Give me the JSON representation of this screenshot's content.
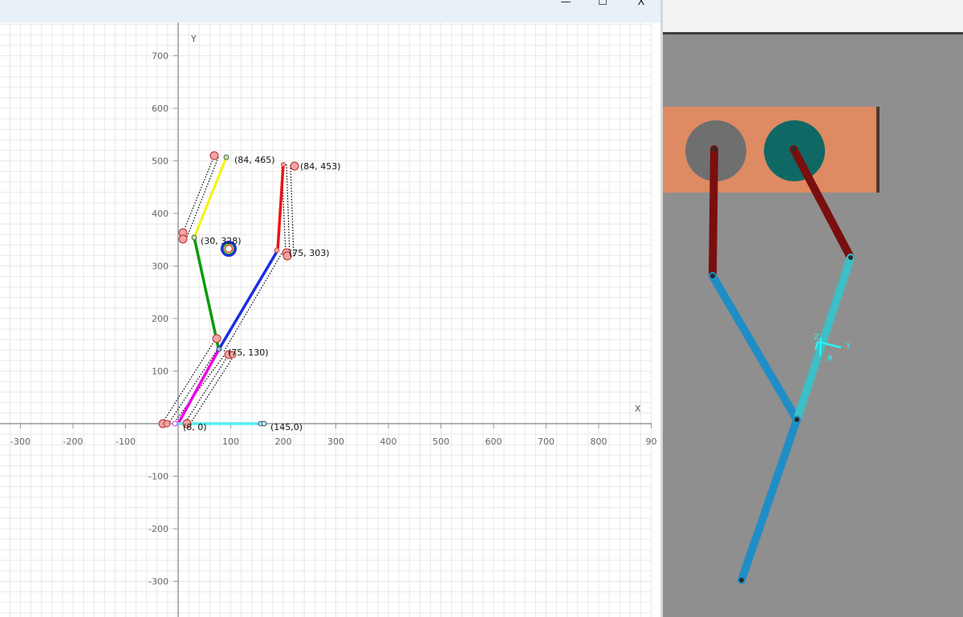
{
  "window_controls": {
    "minimize": "—",
    "maximize": "☐",
    "close": "X"
  },
  "plot": {
    "x_axis_name": "X",
    "y_axis_name": "Y",
    "x_ticks": [
      "-300",
      "-200",
      "-100",
      "100",
      "200",
      "300",
      "400",
      "500",
      "600",
      "700",
      "800",
      "90"
    ],
    "y_ticks": [
      "700",
      "600",
      "500",
      "400",
      "300",
      "200",
      "100",
      "-100",
      "-200",
      "-300"
    ],
    "point_labels": {
      "yellow_top": "(84, 465)",
      "red_top": "(84, 453)",
      "green_joint": "(30, 328)",
      "right_joint": "(75, 303)",
      "middle_joint": "(75, 130)",
      "origin": "(8, 0)",
      "x_axis_end": "(145,0)"
    }
  },
  "colors": {
    "grid": "#e3e3e3",
    "axis": "#999999",
    "yellow_link": "#f5f500",
    "green_link": "#0a9a0a",
    "blue_link": "#1a2ce8",
    "red_link": "#ee1111",
    "magenta_link": "#ee00ee",
    "cyan_link": "#55eeee",
    "marker_fill": "#f4a3a3",
    "marker_stroke": "#b03030",
    "sim_background": "#8f8f8f",
    "sim_plate": "#de8a62",
    "sim_disk_gray": "#6f6f6f",
    "sim_disk_teal": "#0f6864",
    "sim_crank": "#7a0f0f",
    "sim_link_blue": "#1f8ec6",
    "sim_link_cyan": "#3dbfc6",
    "sim_axes": "#2ef0f0"
  },
  "simulation": {
    "axis_labels": {
      "z": "Z",
      "y": "Y",
      "r": "R"
    }
  }
}
